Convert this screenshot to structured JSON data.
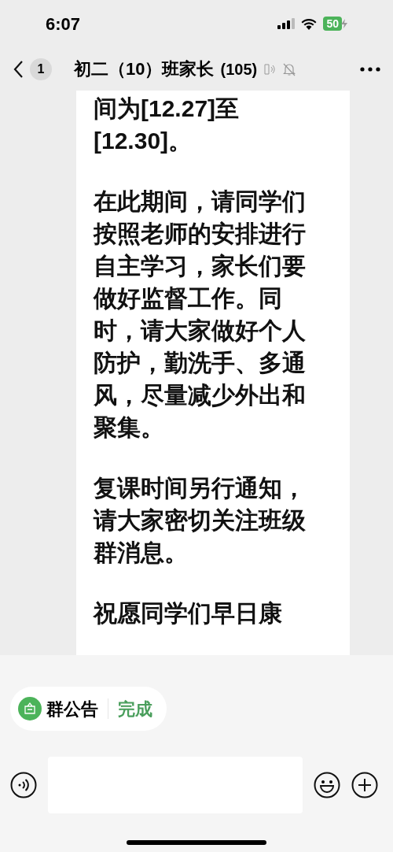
{
  "status_bar": {
    "time": "6:07",
    "battery": "50"
  },
  "nav": {
    "unread": "1",
    "title": "初二（10）班家长",
    "member_count": "(105)",
    "muted": true
  },
  "message": {
    "paragraphs": [
      [
        "间为[12.27]至",
        "[12.30]。"
      ],
      [
        "在此期间，请同学们",
        "按照老师的安排进行",
        "自主学习，家长们要",
        "做好监督工作。同",
        "时，请大家做好个人",
        "防护，勤洗手、多通",
        "风，尽量减少外出和",
        "聚集。"
      ],
      [
        "复课时间另行通知，",
        "请大家密切关注班级",
        "群消息。"
      ],
      [
        "祝愿同学们早日康"
      ]
    ]
  },
  "announcement": {
    "label": "群公告",
    "action": "完成"
  }
}
